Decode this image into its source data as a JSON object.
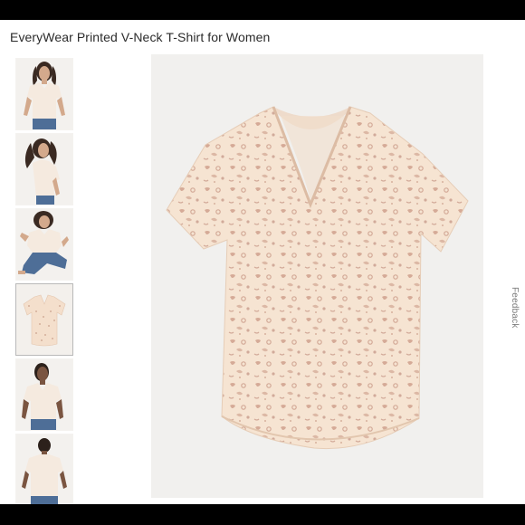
{
  "product": {
    "title": "EveryWear Printed V-Neck T-Shirt for Women"
  },
  "gallery": {
    "selected_index": 3,
    "thumbnails": [
      {
        "view": "model-front"
      },
      {
        "view": "model-side"
      },
      {
        "view": "model-seated"
      },
      {
        "view": "product-flat"
      },
      {
        "view": "model-front-closeup"
      },
      {
        "view": "model-back"
      }
    ]
  },
  "feedback": {
    "label": "Feedback"
  },
  "colors": {
    "page_background": "#ffffff",
    "frame": "#000000",
    "shirt_base": "#f6e6d6",
    "print": "#c69a86",
    "image_background": "#f1f0ee"
  }
}
